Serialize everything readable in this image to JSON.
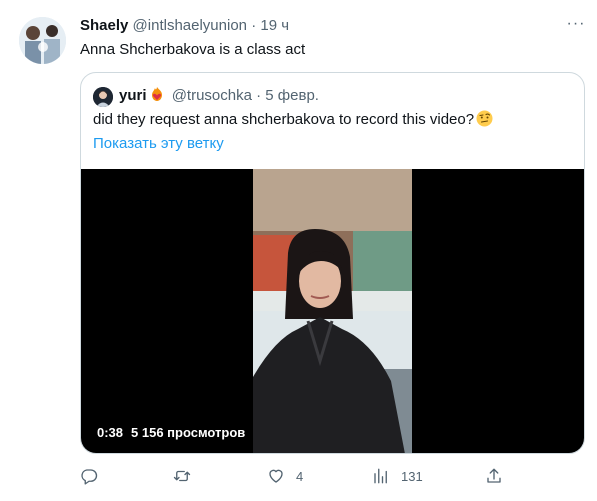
{
  "tweet": {
    "author_name": "Shaely",
    "author_handle": "@intlshaelyunion",
    "separator": "·",
    "time": "19 ч",
    "text": "Anna Shcherbakova is a class act",
    "more_label": "···"
  },
  "quote": {
    "author_name": "yuri",
    "author_handle": "@trusochka",
    "separator": "·",
    "time": "5 февр.",
    "text": "did they request anna shcherbakova to record this video?",
    "show_thread": "Показать эту ветку",
    "video": {
      "duration": "0:38",
      "views": "5 156 просмотров"
    }
  },
  "actions": {
    "reply_count": "",
    "retweet_count": "",
    "like_count": "4",
    "views_count": "131"
  },
  "colors": {
    "text": "#0f1419",
    "secondary": "#536471",
    "link": "#1d9bf0",
    "border": "#cfd9de"
  },
  "icons": {
    "reply": "reply-icon",
    "retweet": "retweet-icon",
    "like": "heart-icon",
    "views": "views-icon",
    "share": "share-icon"
  }
}
